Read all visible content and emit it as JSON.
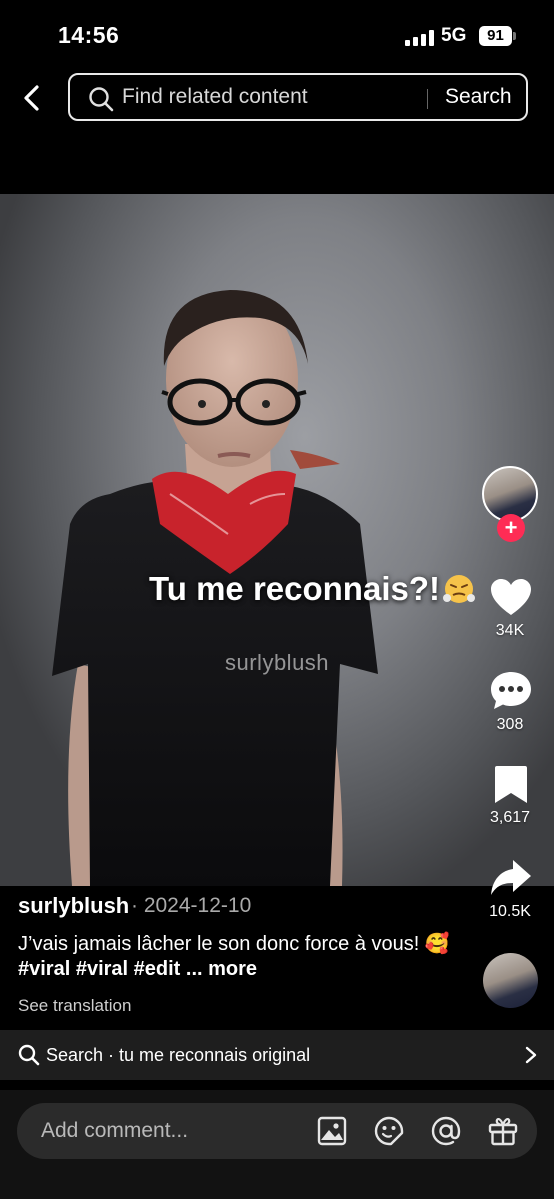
{
  "status_bar": {
    "time": "14:56",
    "network": "5G",
    "battery": "91"
  },
  "search": {
    "placeholder": "Find related content",
    "button": "Search"
  },
  "video": {
    "overlay_text": "Tu me reconnais?!",
    "overlay_emoji": "😤",
    "watermark": "surlyblush"
  },
  "actions": {
    "likes": "34K",
    "comments": "308",
    "saves": "3,617",
    "shares": "10.5K"
  },
  "post": {
    "username": "surlyblush",
    "date": "· 2024-12-10",
    "caption": "J’vais jamais lâcher le son donc force à vous! 🥰",
    "tags": "#viral #viral #edit",
    "more": "... more",
    "see_translation": "See translation"
  },
  "related_search": {
    "text": "Search · tu me reconnais original"
  },
  "comment": {
    "placeholder": "Add comment..."
  },
  "colors": {
    "accent": "#fe2c55",
    "background": "#000000",
    "bar": "#1e1e1e"
  }
}
